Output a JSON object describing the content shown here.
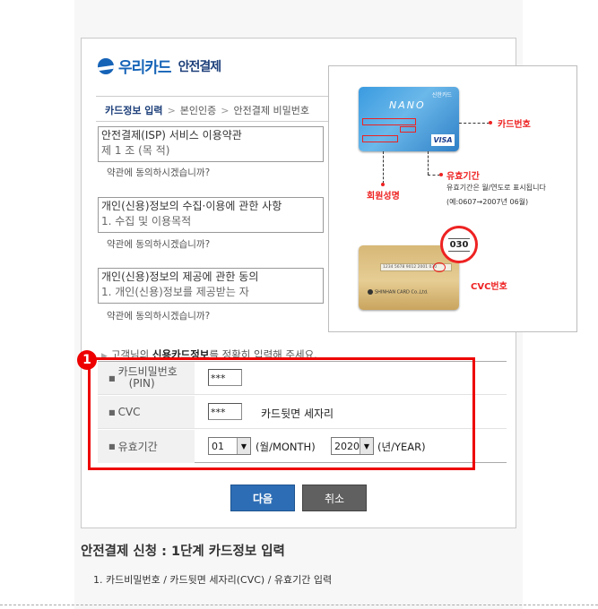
{
  "logo": {
    "brand": "우리카드",
    "sub": "안전결제"
  },
  "steps": [
    {
      "label": "카드정보 입력",
      "active": true
    },
    {
      "label": "본인인증",
      "active": false
    },
    {
      "label": "안전결제 비밀번호",
      "active": false
    }
  ],
  "step_separator": ">",
  "terms": [
    {
      "title": "안전결제(ISP) 서비스 이용약관",
      "cut_line": "제 1 조 (목 적)",
      "agree": "약관에 동의하시겠습니까?"
    },
    {
      "title": "개인(신용)정보의 수집·이용에 관한 사항",
      "cut_line": "1. 수집 및 이용목적",
      "agree": "약관에 동의하시겠습니까?"
    },
    {
      "title": "개인(신용)정보의 제공에 관한 동의",
      "cut_line": "1. 개인(신용)정보를 제공받는 자",
      "agree": "약관에 동의하시겠습니까?"
    }
  ],
  "notice": {
    "pre": "고객님의 ",
    "bold": "신용카드정보",
    "post": "를 정확히 입력해 주세요."
  },
  "form": {
    "pin_label_1": "카드비밀번호",
    "pin_label_2": "(PIN)",
    "pin_value": "***",
    "cvc_label": "CVC",
    "cvc_value": "***",
    "cvc_note": "카드뒷면 세자리",
    "expiry_label": "유효기간",
    "month_value": "01",
    "month_unit": "(월/MONTH)",
    "year_value": "2020",
    "year_unit": "(년/YEAR)"
  },
  "buttons": {
    "next": "다음",
    "cancel": "취소"
  },
  "highlight_badge": "1",
  "card_panel": {
    "front_logo": "NANO",
    "front_brand": "신한카드",
    "visa": "VISA",
    "card_number_label": "카드번호",
    "expiry_label": "유효기간",
    "expiry_note_1": "유효기간은 월/연도로 표시됩니다",
    "expiry_note_2": "(예:0607→2007년 06월)",
    "member_name_label": "회원성명",
    "stripe_text": "1234 5678 9012 2001 030",
    "back_issuer": "SHINHAN CARD Co.,Ltd.",
    "zoom_cvc": "030",
    "cvc_label": "CVC번호"
  },
  "caption": {
    "title": "안전결제 신청 : 1단계 카드정보 입력",
    "item": "1. 카드비밀번호 / 카드뒷면 세자리(CVC) / 유효기간 입력"
  },
  "colors": {
    "brand_blue": "#1563b7",
    "highlight_red": "#ee0000",
    "next_button": "#2d6db5",
    "cancel_button": "#606060"
  }
}
